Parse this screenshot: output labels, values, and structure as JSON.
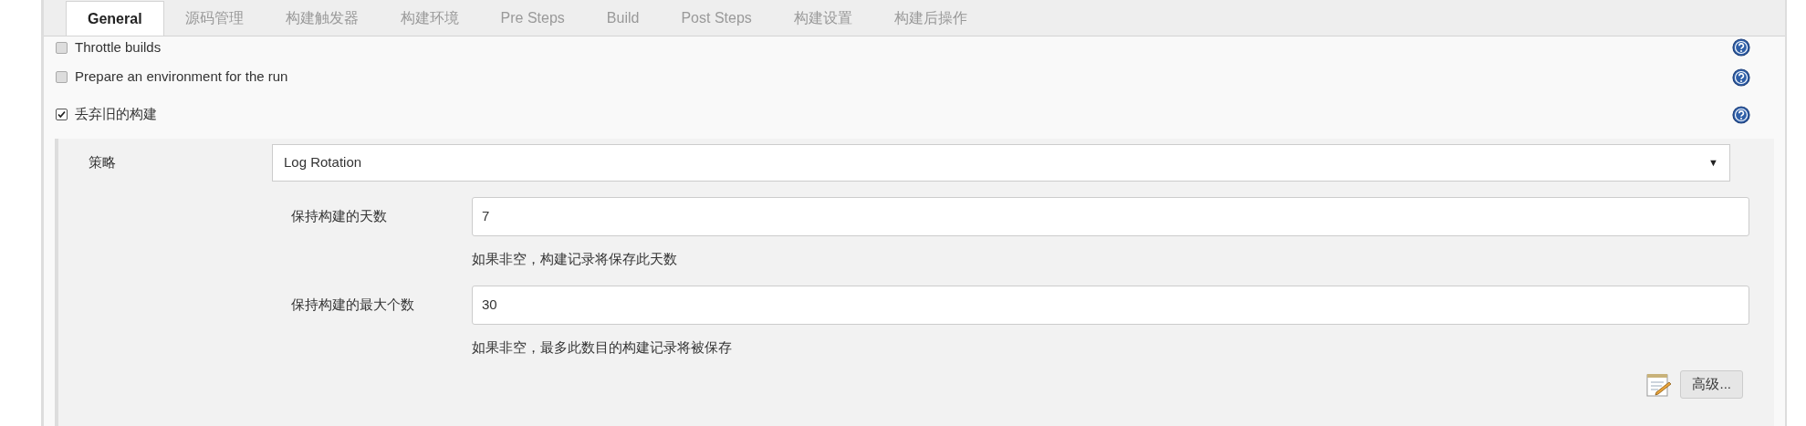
{
  "tabs": [
    {
      "label": "General",
      "selected": true
    },
    {
      "label": "源码管理",
      "selected": false
    },
    {
      "label": "构建触发器",
      "selected": false
    },
    {
      "label": "构建环境",
      "selected": false
    },
    {
      "label": "Pre Steps",
      "selected": false
    },
    {
      "label": "Build",
      "selected": false
    },
    {
      "label": "Post Steps",
      "selected": false
    },
    {
      "label": "构建设置",
      "selected": false
    },
    {
      "label": "构建后操作",
      "selected": false
    }
  ],
  "options": [
    {
      "label": "Throttle builds",
      "checked": false
    },
    {
      "label": "Prepare an environment for the run",
      "checked": false
    },
    {
      "label": "丢弃旧的构建",
      "checked": true
    }
  ],
  "strategy": {
    "label": "策略",
    "value": "Log Rotation",
    "caret": "▼"
  },
  "fields": [
    {
      "label": "保持构建的天数",
      "value": "7",
      "hint": "如果非空，构建记录将保存此天数"
    },
    {
      "label": "保持构建的最大个数",
      "value": "30",
      "hint": "如果非空，最多此数目的构建记录将被保存"
    }
  ],
  "advanced_button": "高级..."
}
